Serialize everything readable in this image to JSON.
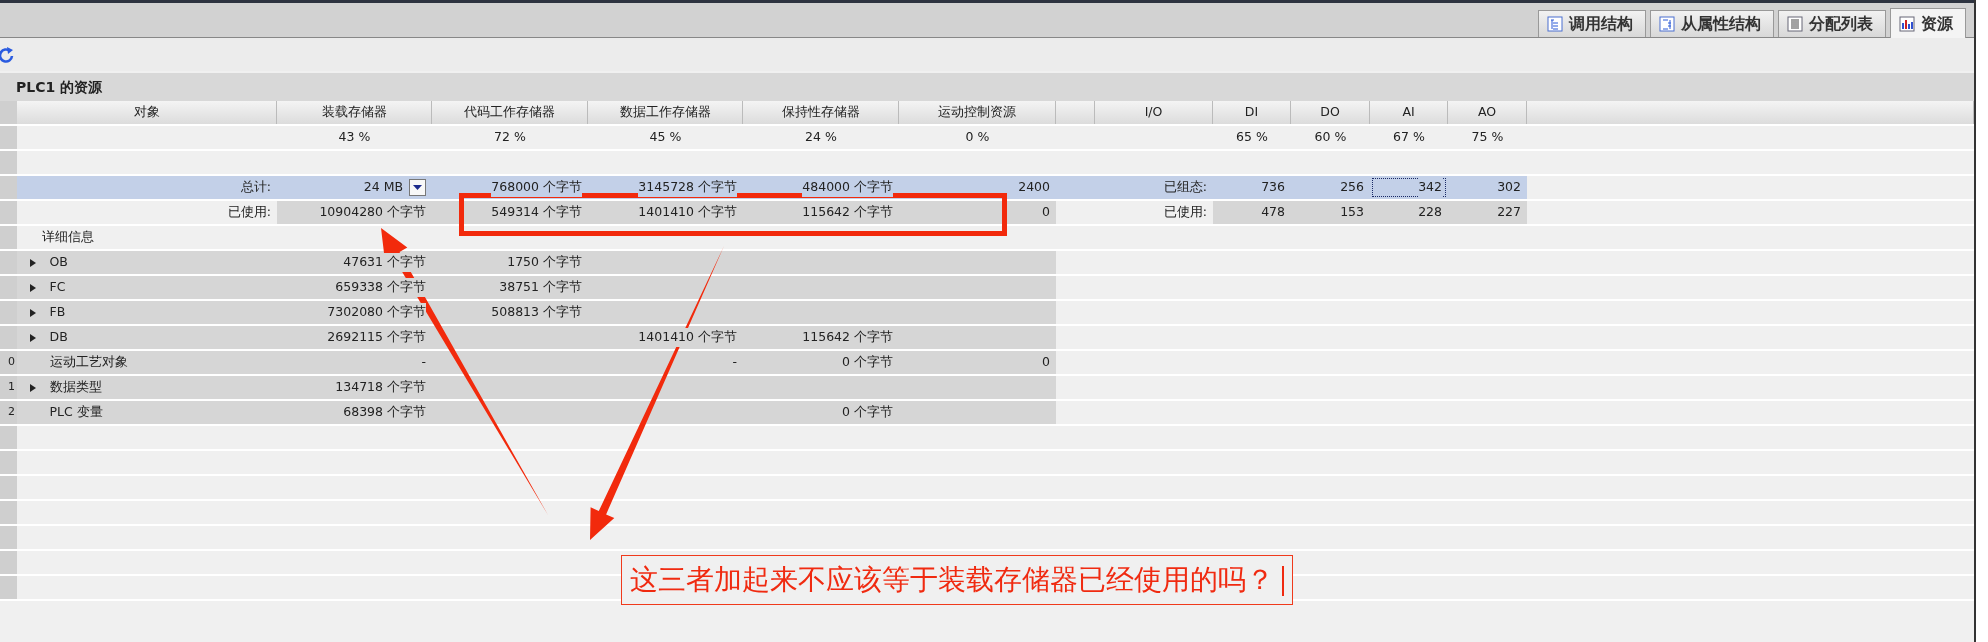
{
  "tabs": [
    {
      "label": "调用结构",
      "selected": false
    },
    {
      "label": "从属性结构",
      "selected": false
    },
    {
      "label": "分配列表",
      "selected": false
    },
    {
      "label": "资源",
      "selected": true
    }
  ],
  "title": "PLC1 的资源",
  "table": {
    "columns": [
      "对象",
      "装载存储器",
      "代码工作存储器",
      "数据工作存储器",
      "保持性存储器",
      "运动控制资源",
      null,
      "I/O",
      "DI",
      "DO",
      "AI",
      "AO"
    ],
    "rows": [
      {
        "kind": "percent",
        "cells": [
          null,
          "43 %",
          "72 %",
          "45 %",
          "24 %",
          "0 %",
          null,
          null,
          "65 %",
          "60 %",
          "67 %",
          "75 %"
        ]
      },
      {
        "kind": "blank"
      },
      {
        "kind": "total",
        "cells": [
          {
            "text": "总计:",
            "selected": false
          },
          {
            "text": "24 MB",
            "selected": false,
            "dropdown": true
          },
          {
            "text": "768000 个字节",
            "selected": false
          },
          {
            "text": "3145728 个字节",
            "selected": false
          },
          {
            "text": "484000 个字节",
            "selected": false
          },
          {
            "text": "2400",
            "selected": false
          },
          null,
          {
            "text": "已组态:",
            "selected": false
          },
          {
            "text": "736",
            "selected": false
          },
          {
            "text": "256",
            "selected": false
          },
          {
            "text": "342",
            "selected": true
          },
          {
            "text": "302",
            "selected": false
          }
        ]
      },
      {
        "kind": "used",
        "cells": [
          "已使用:",
          "10904280 个字节",
          "549314 个字节",
          "1401410 个字节",
          "115642 个字节",
          "0",
          null,
          "已使用:",
          "478",
          "153",
          "228",
          "227"
        ]
      },
      {
        "kind": "section",
        "label": "详细信息"
      },
      {
        "kind": "item",
        "name": "OB",
        "expanded": false,
        "cells": [
          "47631 个字节",
          "1750 个字节",
          null,
          null,
          null
        ]
      },
      {
        "kind": "item",
        "name": "FC",
        "expanded": false,
        "cells": [
          "659338 个字节",
          "38751 个字节",
          null,
          null,
          null
        ]
      },
      {
        "kind": "item",
        "name": "FB",
        "expanded": false,
        "cells": [
          "7302080 个字节",
          "508813 个字节",
          null,
          null,
          null
        ]
      },
      {
        "kind": "item",
        "name": "DB",
        "expanded": false,
        "cells": [
          "2692115 个字节",
          null,
          "1401410 个字节",
          "115642 个字节",
          null
        ]
      },
      {
        "kind": "item",
        "row_number": "0",
        "name": "运动工艺对象",
        "cells": [
          "-",
          null,
          "-",
          "0 个字节",
          "0"
        ]
      },
      {
        "kind": "item",
        "row_number": "1",
        "name": "数据类型",
        "expanded": false,
        "cells": [
          "134718 个字节",
          null,
          null,
          null,
          null
        ]
      },
      {
        "kind": "item",
        "row_number": "2",
        "name": "PLC 变量",
        "cells": [
          "68398 个字节",
          null,
          null,
          "0 个字节",
          null
        ]
      }
    ]
  },
  "annotation": {
    "text": "这三者加起来不应该等于装载存储器已经使用的吗？"
  }
}
